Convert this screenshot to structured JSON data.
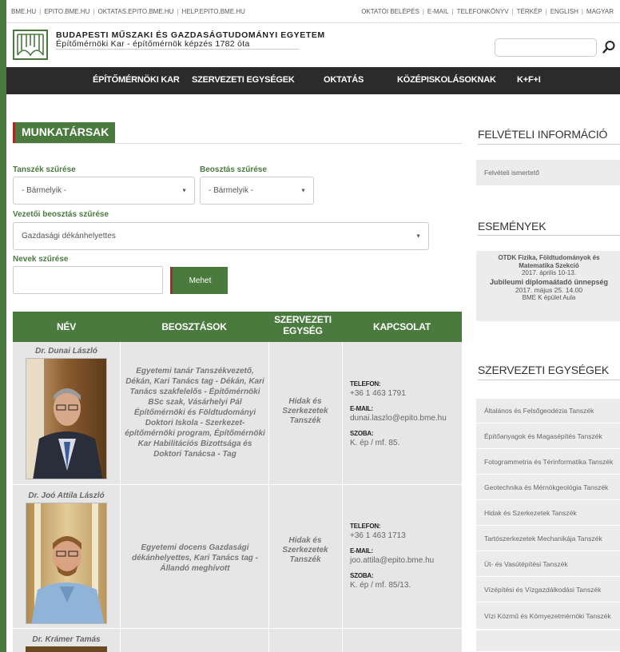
{
  "topbar": {
    "left_links": [
      "BME.HU",
      "EPITO.BME.HU",
      "OKTATAS.EPITO.BME.HU",
      "HELP.EPITO.BME.HU"
    ],
    "right_links": [
      "OKTATÓI BELÉPÉS",
      "E-MAIL",
      "TELEFONKÖNYV",
      "TÉRKÉP",
      "ENGLISH",
      "MAGYAR"
    ]
  },
  "header": {
    "university": "BUDAPESTI MŰSZAKI ÉS GAZDASÁGTUDOMÁNYI EGYETEM",
    "faculty": "Építőmérnöki Kar - építőmérnök képzés 1782 óta",
    "search_placeholder": ""
  },
  "nav": [
    "ÉPÍTŐMÉRNÖKI KAR",
    "SZERVEZETI EGYSÉGEK",
    "OKTATÁS",
    "KÖZÉPISKOLÁSOKNAK",
    "K+F+I"
  ],
  "main": {
    "title": "MUNKATÁRSAK",
    "filter_dept_label": "Tanszék szűrése",
    "filter_dept_value": "- Bármelyik -",
    "filter_pos_label": "Beosztás szűrése",
    "filter_pos_value": "- Bármelyik -",
    "filter_lead_label": "Vezetői beosztás szűrése",
    "filter_lead_value": "Gazdasági dékánhelyettes",
    "filter_names_label": "Nevek szűrése",
    "names_value": "",
    "go_label": "Mehet"
  },
  "table": {
    "headers": [
      "NÉV",
      "BEOSZTÁSOK",
      "SZERVEZETI EGYSÉG",
      "KAPCSOLAT"
    ],
    "rows": [
      {
        "name": "Dr. Dunai László",
        "positions": "Egyetemi tanár Tanszékvezető, Dékán, Kari Tanács tag - Dékán, Kari Tanács szakfelelős - Építőmérnöki BSc szak, Vásárhelyi Pál Építőmérnöki és Földtudományi Doktori Iskola - Szerkezet-építőmérnöki program, Építőmérnöki Kar Habilitációs Bizottsága és Doktori Tanácsa - Tag",
        "unit": "Hidak és Szerkezetek Tanszék",
        "phone_label": "TELEFON:",
        "phone": "+36 1 463 1791",
        "email_label": "E-MAIL:",
        "email": "dunai.laszlo@epito.bme.hu",
        "room_label": "SZOBA:",
        "room": "K. ép / mf. 85."
      },
      {
        "name": "Dr. Joó Attila László",
        "positions": "Egyetemi docens Gazdasági dékánhelyettes, Kari Tanács tag - Állandó meghívott",
        "unit": "Hidak és Szerkezetek Tanszék",
        "phone_label": "TELEFON:",
        "phone": "+36 1 463 1713",
        "email_label": "E-MAIL:",
        "email": "joo.attila@epito.bme.hu",
        "room_label": "SZOBA:",
        "room": "K. ép / mf. 85/13."
      },
      {
        "name": "Dr. Krámer Tamás"
      }
    ]
  },
  "sidebar": {
    "admission_title": "FELVÉTELI INFORMÁCIÓ",
    "admission_link": "Felvételi ismertető",
    "events_title": "ESEMÉNYEK",
    "events": [
      {
        "title": "OTDK Fizika, Földtudományok és Matematika Szekció",
        "date": "2017. április 10-13."
      },
      {
        "title": "Jubileumi diplomaátadó ünnepség",
        "date": "2017. május 25. 14.00",
        "place": "BME K épület Aula"
      }
    ],
    "units_title": "SZERVEZETI EGYSÉGEK",
    "units": [
      "Általános és Felsőgeodézia Tanszék",
      "Építőanyagok és Magasépítés Tanszék",
      "Fotogrammetria és Térinformatika Tanszék",
      "Geotechnika és Mérnökgeológia Tanszék",
      "Hidak és Szerkezetek Tanszék",
      "Tartószerkezetek Mechanikája Tanszék",
      "Út- és Vasútépítési Tanszék",
      "Vízépítési és Vízgazdálkodási Tanszék",
      "Vízi Közmű és Környezetmérnöki Tanszék"
    ]
  },
  "colors": {
    "brand_green": "#4a7a3e",
    "accent_red": "#a52a2a",
    "nav_dark": "#2b2b2b"
  }
}
